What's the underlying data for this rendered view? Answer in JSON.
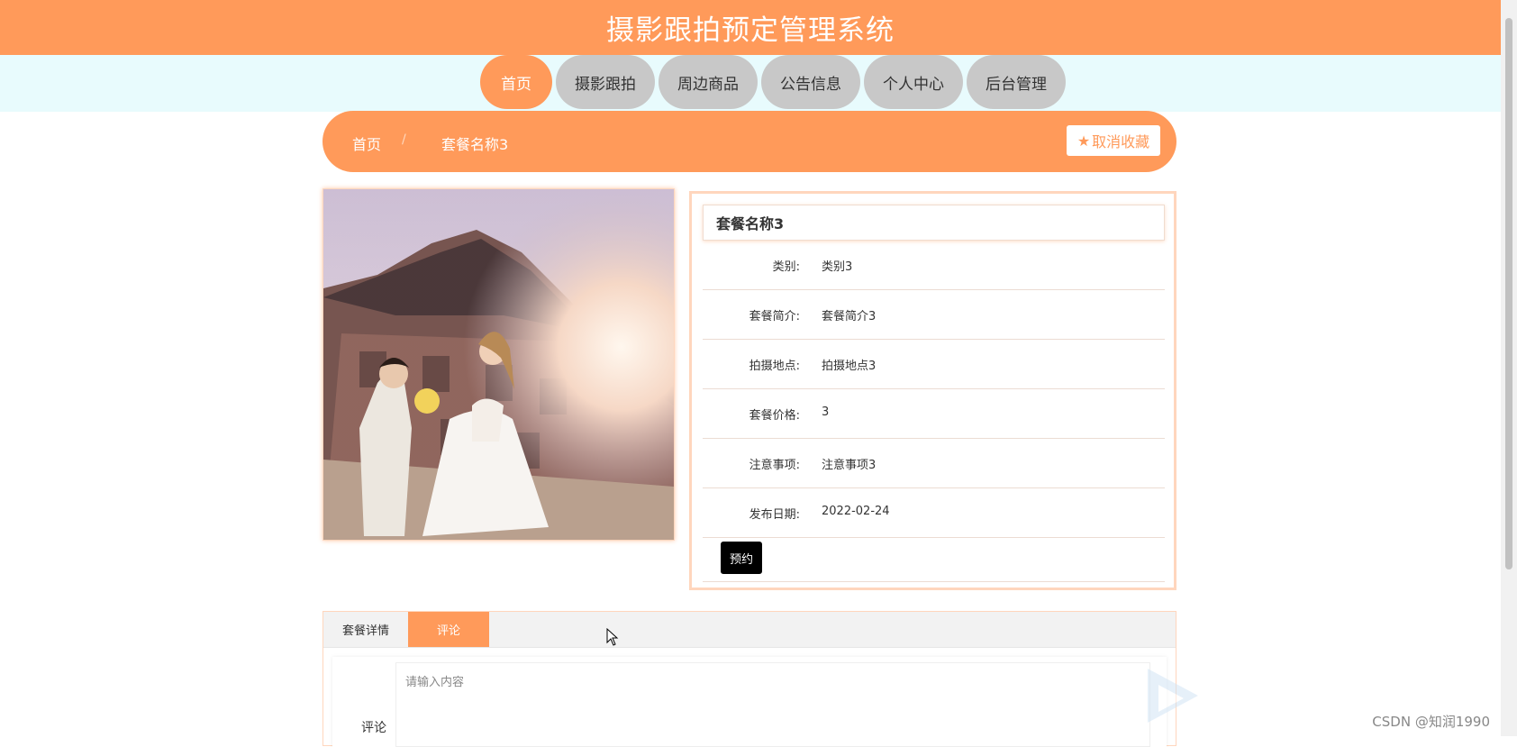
{
  "header": {
    "title": "摄影跟拍预定管理系统"
  },
  "nav": {
    "items": [
      {
        "label": "首页",
        "active": true
      },
      {
        "label": "摄影跟拍"
      },
      {
        "label": "周边商品"
      },
      {
        "label": "公告信息"
      },
      {
        "label": "个人中心"
      },
      {
        "label": "后台管理"
      }
    ]
  },
  "breadcrumb": {
    "home": "首页",
    "separator": "/",
    "current": "套餐名称3",
    "favorite_label": "取消收藏",
    "favorite_icon": "star-icon"
  },
  "product": {
    "name": "套餐名称3",
    "fields": [
      {
        "label": "类别:",
        "value": "类别3"
      },
      {
        "label": "套餐简介:",
        "value": "套餐简介3"
      },
      {
        "label": "拍摄地点:",
        "value": "拍摄地点3"
      },
      {
        "label": "套餐价格:",
        "value": "3"
      },
      {
        "label": "注意事项:",
        "value": "注意事项3"
      },
      {
        "label": "发布日期:",
        "value": "2022-02-24"
      }
    ],
    "book_label": "预约"
  },
  "tabs": {
    "items": [
      {
        "label": "套餐详情"
      },
      {
        "label": "评论",
        "active": true
      }
    ]
  },
  "comment": {
    "label": "评论",
    "placeholder": "请输入内容"
  },
  "watermark": "CSDN @知润1990",
  "colors": {
    "accent": "#ff9a5a",
    "nav_bg": "#e8fbfd",
    "tab_inactive": "#c8c8c8"
  }
}
